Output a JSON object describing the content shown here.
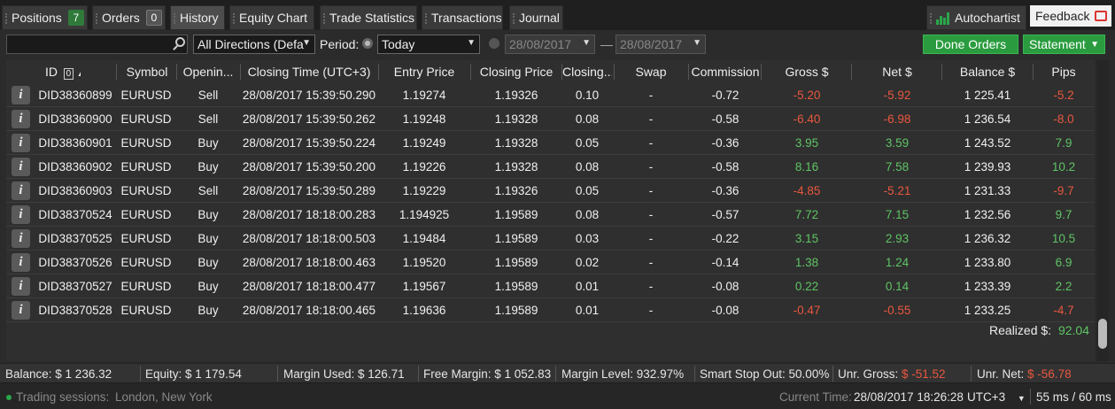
{
  "tabs": {
    "positions": {
      "label": "Positions",
      "count": "7"
    },
    "orders": {
      "label": "Orders",
      "count": "0"
    },
    "history": {
      "label": "History"
    },
    "equity_chart": {
      "label": "Equity Chart"
    },
    "trade_statistics": {
      "label": "Trade Statistics"
    },
    "transactions": {
      "label": "Transactions"
    },
    "journal": {
      "label": "Journal"
    },
    "autochartist": {
      "label": "Autochartist"
    },
    "feedback": {
      "label": "Feedback"
    }
  },
  "filters": {
    "search_value": "",
    "direction": "All Directions (Defa",
    "period_label": "Period:",
    "period_value": "Today",
    "date_from": "28/08/2017",
    "date_to": "28/08/2017",
    "dash": "—",
    "done_orders": "Done Orders",
    "statement": "Statement"
  },
  "table": {
    "headers": {
      "id": "ID",
      "id_badge": "0",
      "symbol": "Symbol",
      "opening": "Openin...",
      "closing_time": "Closing Time (UTC+3)",
      "entry_price": "Entry Price",
      "closing_price": "Closing Price",
      "closing_qty": "Closing...",
      "swap": "Swap",
      "commission": "Commission",
      "gross": "Gross $",
      "net": "Net $",
      "balance": "Balance $",
      "pips": "Pips"
    },
    "rows": [
      {
        "id": "DID38360899",
        "symbol": "EURUSD",
        "dir": "Sell",
        "time": "28/08/2017 15:39:50.290",
        "entry": "1.19274",
        "close": "1.19326",
        "qty": "0.10",
        "swap": "-",
        "comm": "-0.72",
        "gross": "-5.20",
        "net": "-5.92",
        "balance": "1 225.41",
        "pips": "-5.2"
      },
      {
        "id": "DID38360900",
        "symbol": "EURUSD",
        "dir": "Sell",
        "time": "28/08/2017 15:39:50.262",
        "entry": "1.19248",
        "close": "1.19328",
        "qty": "0.08",
        "swap": "-",
        "comm": "-0.58",
        "gross": "-6.40",
        "net": "-6.98",
        "balance": "1 236.54",
        "pips": "-8.0"
      },
      {
        "id": "DID38360901",
        "symbol": "EURUSD",
        "dir": "Buy",
        "time": "28/08/2017 15:39:50.224",
        "entry": "1.19249",
        "close": "1.19328",
        "qty": "0.05",
        "swap": "-",
        "comm": "-0.36",
        "gross": "3.95",
        "net": "3.59",
        "balance": "1 243.52",
        "pips": "7.9"
      },
      {
        "id": "DID38360902",
        "symbol": "EURUSD",
        "dir": "Buy",
        "time": "28/08/2017 15:39:50.200",
        "entry": "1.19226",
        "close": "1.19328",
        "qty": "0.08",
        "swap": "-",
        "comm": "-0.58",
        "gross": "8.16",
        "net": "7.58",
        "balance": "1 239.93",
        "pips": "10.2"
      },
      {
        "id": "DID38360903",
        "symbol": "EURUSD",
        "dir": "Sell",
        "time": "28/08/2017 15:39:50.289",
        "entry": "1.19229",
        "close": "1.19326",
        "qty": "0.05",
        "swap": "-",
        "comm": "-0.36",
        "gross": "-4.85",
        "net": "-5.21",
        "balance": "1 231.33",
        "pips": "-9.7"
      },
      {
        "id": "DID38370524",
        "symbol": "EURUSD",
        "dir": "Buy",
        "time": "28/08/2017 18:18:00.283",
        "entry": "1.194925",
        "close": "1.19589",
        "qty": "0.08",
        "swap": "-",
        "comm": "-0.57",
        "gross": "7.72",
        "net": "7.15",
        "balance": "1 232.56",
        "pips": "9.7"
      },
      {
        "id": "DID38370525",
        "symbol": "EURUSD",
        "dir": "Buy",
        "time": "28/08/2017 18:18:00.503",
        "entry": "1.19484",
        "close": "1.19589",
        "qty": "0.03",
        "swap": "-",
        "comm": "-0.22",
        "gross": "3.15",
        "net": "2.93",
        "balance": "1 236.32",
        "pips": "10.5"
      },
      {
        "id": "DID38370526",
        "symbol": "EURUSD",
        "dir": "Buy",
        "time": "28/08/2017 18:18:00.463",
        "entry": "1.19520",
        "close": "1.19589",
        "qty": "0.02",
        "swap": "-",
        "comm": "-0.14",
        "gross": "1.38",
        "net": "1.24",
        "balance": "1 233.80",
        "pips": "6.9"
      },
      {
        "id": "DID38370527",
        "symbol": "EURUSD",
        "dir": "Buy",
        "time": "28/08/2017 18:18:00.477",
        "entry": "1.19567",
        "close": "1.19589",
        "qty": "0.01",
        "swap": "-",
        "comm": "-0.08",
        "gross": "0.22",
        "net": "0.14",
        "balance": "1 233.39",
        "pips": "2.2"
      },
      {
        "id": "DID38370528",
        "symbol": "EURUSD",
        "dir": "Buy",
        "time": "28/08/2017 18:18:00.465",
        "entry": "1.19636",
        "close": "1.19589",
        "qty": "0.01",
        "swap": "-",
        "comm": "-0.08",
        "gross": "-0.47",
        "net": "-0.55",
        "balance": "1 233.25",
        "pips": "-4.7"
      }
    ],
    "realized_label": "Realized $:",
    "realized_value": "92.04"
  },
  "status": {
    "balance": "Balance: $ 1 236.32",
    "equity": "Equity: $ 1 179.54",
    "margin_used": "Margin Used: $ 126.71",
    "free_margin": "Free Margin: $ 1 052.83",
    "margin_level": "Margin Level: 932.97%",
    "smart_stop_out": "Smart Stop Out: 50.00%",
    "unr_gross_label": "Unr. Gross:",
    "unr_gross_value": "$ -51.52",
    "unr_net_label": "Unr. Net:",
    "unr_net_value": "$ -56.78"
  },
  "footer": {
    "sessions_label": "Trading sessions:",
    "sessions_value": "London, New York",
    "current_time_label": "Current Time:",
    "current_time_value": "28/08/2017 18:26:28",
    "timezone": "UTC+3",
    "latency": "55 ms / 60 ms"
  },
  "colors": {
    "positive": "#5fc465",
    "negative": "#e9573f",
    "accent_green": "#2a9c3f"
  }
}
